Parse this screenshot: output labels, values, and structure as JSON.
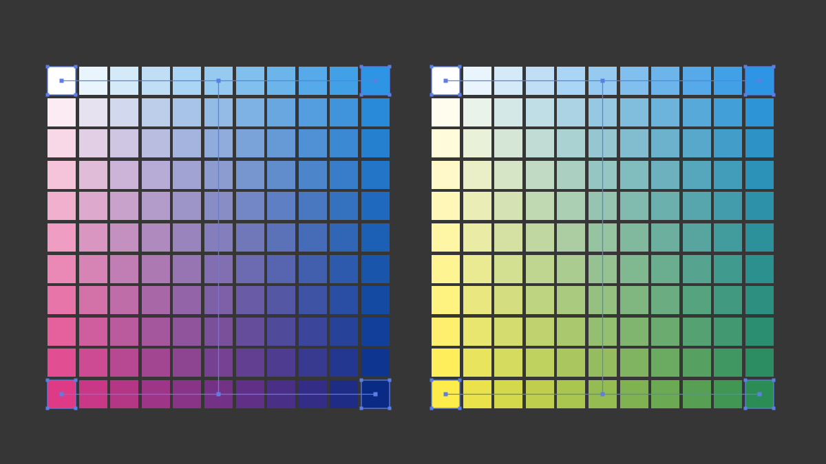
{
  "colors": {
    "background": "#363636",
    "selection": "#5b7fe6"
  },
  "grids": [
    {
      "corners": {
        "top_left": "#ffffff",
        "top_right": "#2d95e3",
        "bottom_left": "#de3a86",
        "bottom_right": "#0a2a86"
      },
      "rows": 11,
      "cols": 11
    },
    {
      "corners": {
        "top_left": "#ffffff",
        "top_right": "#2d95e3",
        "bottom_left": "#feec4a",
        "bottom_right": "#2c8c55"
      },
      "rows": 11,
      "cols": 11
    }
  ],
  "handles": {
    "corner_handles_icon": "square-handle-icon",
    "anchor_icon": "anchor-point-icon"
  }
}
